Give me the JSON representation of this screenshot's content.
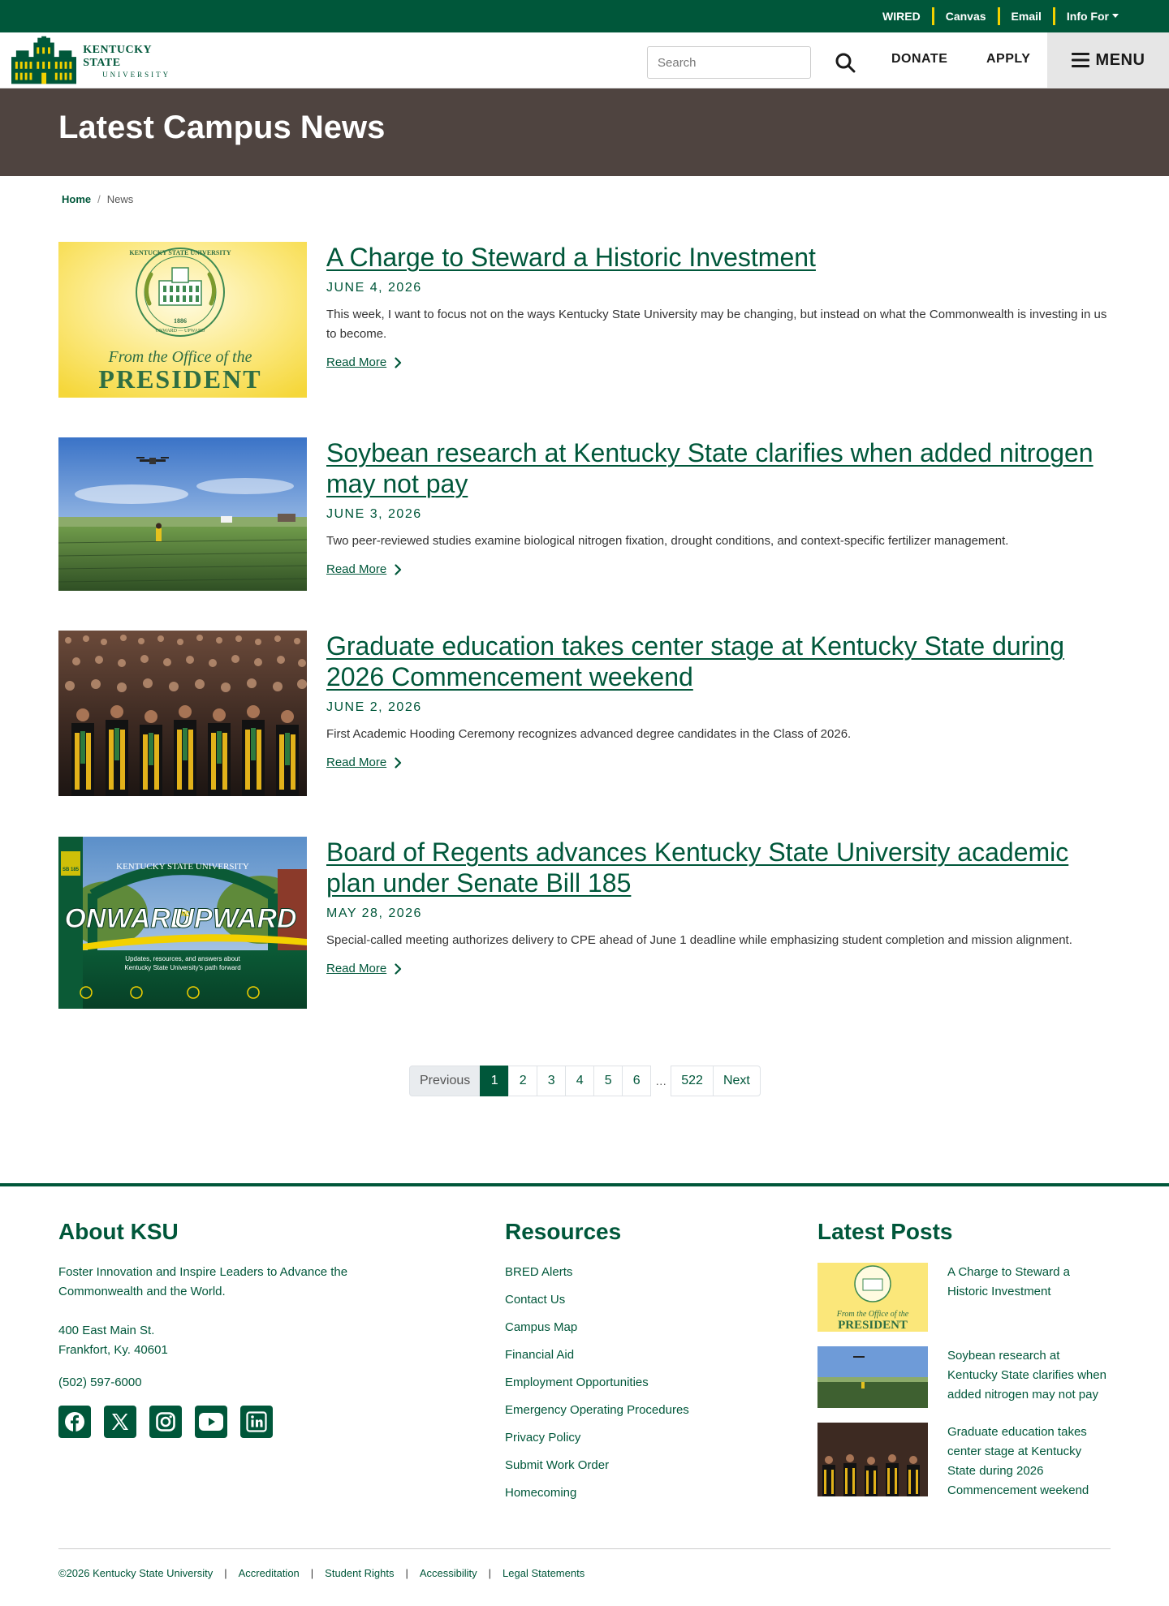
{
  "utility_bar": {
    "links": [
      "WIRED",
      "Canvas",
      "Email"
    ],
    "info_for": "Info For"
  },
  "header": {
    "logo_line1": "KENTUCKY STATE",
    "logo_line2": "UNIVERSITY",
    "search_placeholder": "Search",
    "search_value": "",
    "donate": "DONATE",
    "apply": "APPLY",
    "menu": "MENU"
  },
  "hero": {
    "title": "Latest Campus News"
  },
  "breadcrumb": {
    "home": "Home",
    "current": "News"
  },
  "articles": [
    {
      "title": "A Charge to Steward a Historic Investment",
      "date": "JUNE 4, 2026",
      "excerpt": "This week, I want to focus not on the ways Kentucky State University may be changing, but instead on what the Commonwealth is investing in us to become.",
      "read_more": "Read More",
      "image": {
        "seal_top": "KENTUCKY STATE UNIVERSITY",
        "seal_year": "1886",
        "seal_bottom": "ONWARD — UPWARD",
        "line1": "From the Office of the",
        "line2": "PRESIDENT"
      }
    },
    {
      "title": "Soybean research at Kentucky State clarifies when added nitrogen may not pay",
      "date": "JUNE 3, 2026",
      "excerpt": "Two peer-reviewed studies examine biological nitrogen fixation, drought conditions, and context-specific fertilizer management.",
      "read_more": "Read More"
    },
    {
      "title": "Graduate education takes center stage at Kentucky State during 2026 Commencement weekend",
      "date": "JUNE 2, 2026",
      "excerpt": "First Academic Hooding Ceremony recognizes advanced degree candidates in the Class of 2026.",
      "read_more": "Read More"
    },
    {
      "title": "Board of Regents advances Kentucky State University academic plan under Senate Bill 185",
      "date": "MAY 28, 2026",
      "excerpt": "Special-called meeting authorizes delivery to CPE ahead of June 1 deadline while emphasizing student completion and mission alignment.",
      "read_more": "Read More",
      "image": {
        "arch": "KENTUCKY STATE UNIVERSITY",
        "headline_a": "ONWARD",
        "headline_and": "AND",
        "headline_b": "UPWARD",
        "sub1": "Updates, resources, and answers about",
        "sub2": "Kentucky State University's path forward",
        "badge": "SB 185"
      }
    }
  ],
  "pagination": {
    "previous": "Previous",
    "pages": [
      "1",
      "2",
      "3",
      "4",
      "5",
      "6"
    ],
    "ellipsis": "…",
    "last": "522",
    "next": "Next",
    "current": "1"
  },
  "footer": {
    "about": {
      "heading": "About KSU",
      "mission": "Foster Innovation and Inspire Leaders to Advance the Commonwealth and the World.",
      "address1": "400 East Main St.",
      "address2": "Frankfort, Ky. 40601",
      "phone": "(502) 597-6000"
    },
    "resources": {
      "heading": "Resources",
      "links": [
        "BRED Alerts",
        "Contact Us",
        "Campus Map",
        "Financial Aid",
        "Employment Opportunities",
        "Emergency Operating Procedures",
        "Privacy Policy",
        "Submit Work Order",
        "Homecoming"
      ]
    },
    "latest": {
      "heading": "Latest Posts",
      "posts": [
        "A Charge to Steward a Historic Investment",
        "Soybean research at Kentucky State clarifies when added nitrogen may not pay",
        "Graduate education takes center stage at Kentucky State during 2026 Commencement weekend"
      ],
      "thumb_line1": "From the Office of the",
      "thumb_line2": "PRESIDENT"
    },
    "social": [
      "facebook-icon",
      "x-icon",
      "instagram-icon",
      "youtube-icon",
      "linkedin-icon"
    ],
    "legal": {
      "copyright": "©2026 Kentucky State University",
      "links": [
        "Accreditation",
        "Student Rights",
        "Accessibility",
        "Legal Statements"
      ]
    }
  },
  "colors": {
    "brand_green": "#00573a",
    "accent_gold": "#f2d100",
    "hero_brown": "#4f4440"
  }
}
